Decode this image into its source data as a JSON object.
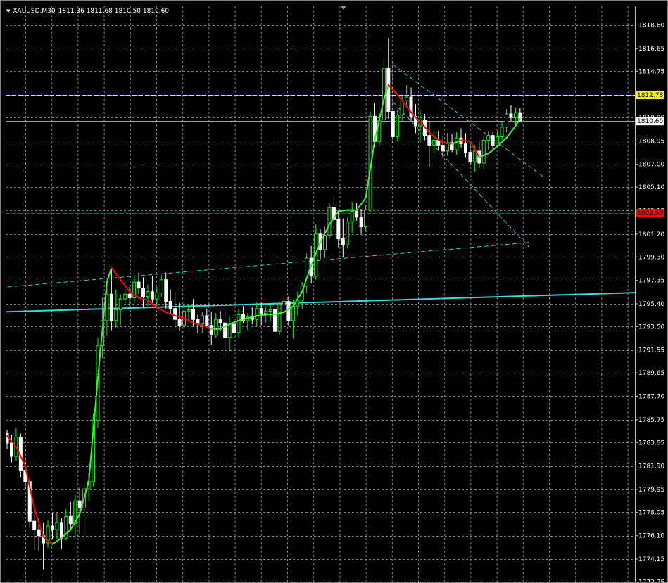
{
  "header": {
    "symbol_timeframe": "XAUUSD,M30",
    "ohlc": "1811.36 1811.68 1810.50 1810.60"
  },
  "colors": {
    "background": "#000000",
    "grid": "#808080",
    "bull_candle": "#00ff00",
    "bear_candle": "#ffffff",
    "ma_up": "#44ee44",
    "ma_down": "#ff0000",
    "support_line": "#33dddd",
    "dashed_channel": "#33cccc",
    "yellow_level": "#ffff00",
    "red_level": "#ff0000",
    "bid_line": "#9aa0a8"
  },
  "chart_data": {
    "type": "candlestick",
    "title": "",
    "xlabel": "",
    "ylabel": "",
    "grid": true,
    "ylim": [
      1772.25,
      1819.9
    ],
    "y_ticks": [
      "1818.60",
      "1816.65",
      "1814.75",
      "1812.80",
      "1810.90",
      "1808.95",
      "1807.00",
      "1805.10",
      "1803.15",
      "1801.20",
      "1799.30",
      "1797.35",
      "1795.40",
      "1793.50",
      "1791.55",
      "1789.65",
      "1787.70",
      "1785.75",
      "1783.85",
      "1781.90",
      "1779.95",
      "1778.05",
      "1776.10",
      "1774.15",
      "1772.25"
    ],
    "price_tags": [
      {
        "label": "1812.78",
        "value": 1812.78,
        "color": "#ffff00",
        "text_color": "#000000"
      },
      {
        "label": "1810.60",
        "value": 1810.6,
        "color": "#ffffff",
        "text_color": "#000000"
      },
      {
        "label": "1802.95",
        "value": 1802.95,
        "color": "#ff0000",
        "text_color": "#000000"
      }
    ],
    "candles": [
      [
        1784.6,
        1784.9,
        1783.3,
        1783.8
      ],
      [
        1783.8,
        1784.5,
        1782.2,
        1782.7
      ],
      [
        1782.7,
        1785.1,
        1782.3,
        1784.3
      ],
      [
        1784.3,
        1784.6,
        1781.0,
        1781.5
      ],
      [
        1781.5,
        1782.6,
        1780.0,
        1780.6
      ],
      [
        1780.6,
        1780.9,
        1776.7,
        1777.3
      ],
      [
        1777.3,
        1778.1,
        1774.9,
        1776.6
      ],
      [
        1776.6,
        1777.6,
        1774.8,
        1776.1
      ],
      [
        1776.1,
        1777.2,
        1773.3,
        1775.5
      ],
      [
        1775.5,
        1777.4,
        1775.1,
        1776.9
      ],
      [
        1776.9,
        1778.0,
        1775.8,
        1776.6
      ],
      [
        1776.6,
        1778.0,
        1775.8,
        1777.2
      ],
      [
        1777.2,
        1777.6,
        1775.0,
        1775.9
      ],
      [
        1775.9,
        1778.3,
        1775.7,
        1777.7
      ],
      [
        1777.7,
        1778.9,
        1776.6,
        1777.1
      ],
      [
        1777.1,
        1779.5,
        1775.9,
        1779.0
      ],
      [
        1779.0,
        1780.1,
        1776.2,
        1778.4
      ],
      [
        1778.4,
        1780.4,
        1775.7,
        1780.0
      ],
      [
        1780.0,
        1781.3,
        1779.0,
        1780.6
      ],
      [
        1780.6,
        1786.3,
        1780.2,
        1785.7
      ],
      [
        1785.7,
        1792.6,
        1785.1,
        1791.9
      ],
      [
        1791.9,
        1795.9,
        1790.9,
        1794.0
      ],
      [
        1794.0,
        1797.1,
        1792.7,
        1796.2
      ],
      [
        1796.2,
        1798.4,
        1793.2,
        1794.0
      ],
      [
        1794.0,
        1796.6,
        1793.4,
        1794.9
      ],
      [
        1794.9,
        1796.2,
        1793.6,
        1795.8
      ],
      [
        1795.8,
        1797.4,
        1795.3,
        1796.2
      ],
      [
        1796.2,
        1796.8,
        1795.2,
        1795.9
      ],
      [
        1795.9,
        1797.8,
        1795.5,
        1797.2
      ],
      [
        1797.2,
        1798.0,
        1796.2,
        1796.7
      ],
      [
        1796.7,
        1797.6,
        1795.1,
        1796.0
      ],
      [
        1796.0,
        1797.0,
        1795.2,
        1796.4
      ],
      [
        1796.4,
        1797.7,
        1795.4,
        1795.8
      ],
      [
        1795.8,
        1796.8,
        1795.0,
        1796.3
      ],
      [
        1796.3,
        1797.8,
        1796.0,
        1797.4
      ],
      [
        1797.4,
        1798.0,
        1795.0,
        1795.6
      ],
      [
        1795.6,
        1796.6,
        1794.6,
        1795.0
      ],
      [
        1795.0,
        1796.4,
        1793.4,
        1794.1
      ],
      [
        1794.1,
        1795.5,
        1793.2,
        1793.6
      ],
      [
        1793.6,
        1795.2,
        1792.8,
        1794.8
      ],
      [
        1794.8,
        1795.4,
        1794.0,
        1794.9
      ],
      [
        1794.9,
        1795.8,
        1793.6,
        1794.1
      ],
      [
        1794.1,
        1794.5,
        1793.0,
        1793.7
      ],
      [
        1793.7,
        1794.7,
        1793.0,
        1794.4
      ],
      [
        1794.4,
        1795.0,
        1793.4,
        1793.6
      ],
      [
        1793.6,
        1794.7,
        1792.0,
        1792.8
      ],
      [
        1792.8,
        1794.6,
        1792.6,
        1794.1
      ],
      [
        1794.1,
        1794.8,
        1793.1,
        1793.8
      ],
      [
        1793.8,
        1795.0,
        1791.0,
        1792.6
      ],
      [
        1792.6,
        1794.3,
        1791.5,
        1793.7
      ],
      [
        1793.7,
        1794.4,
        1792.5,
        1793.0
      ],
      [
        1793.0,
        1795.0,
        1792.6,
        1794.5
      ],
      [
        1794.5,
        1795.2,
        1793.8,
        1794.0
      ],
      [
        1794.0,
        1794.6,
        1793.2,
        1794.3
      ],
      [
        1794.3,
        1795.1,
        1793.7,
        1794.1
      ],
      [
        1794.1,
        1795.5,
        1793.5,
        1795.0
      ],
      [
        1795.0,
        1795.5,
        1793.6,
        1794.6
      ],
      [
        1794.6,
        1795.2,
        1793.8,
        1794.8
      ],
      [
        1794.8,
        1795.3,
        1794.0,
        1794.9
      ],
      [
        1794.9,
        1795.4,
        1792.5,
        1793.1
      ],
      [
        1793.1,
        1795.6,
        1792.8,
        1795.3
      ],
      [
        1795.3,
        1795.9,
        1794.5,
        1795.6
      ],
      [
        1795.6,
        1796.0,
        1793.6,
        1794.0
      ],
      [
        1794.0,
        1795.7,
        1792.5,
        1795.2
      ],
      [
        1795.2,
        1796.4,
        1794.4,
        1795.7
      ],
      [
        1795.7,
        1797.2,
        1795.0,
        1796.9
      ],
      [
        1796.9,
        1799.6,
        1796.3,
        1799.2
      ],
      [
        1799.2,
        1800.2,
        1797.1,
        1797.7
      ],
      [
        1797.7,
        1802.0,
        1797.4,
        1801.2
      ],
      [
        1801.2,
        1801.6,
        1799.1,
        1799.9
      ],
      [
        1799.9,
        1801.8,
        1799.2,
        1801.1
      ],
      [
        1801.1,
        1803.8,
        1800.8,
        1803.4
      ],
      [
        1803.4,
        1804.3,
        1801.6,
        1802.4
      ],
      [
        1802.4,
        1803.2,
        1800.1,
        1800.8
      ],
      [
        1800.8,
        1802.5,
        1799.3,
        1800.3
      ],
      [
        1800.3,
        1802.6,
        1800.0,
        1802.2
      ],
      [
        1802.2,
        1803.9,
        1801.3,
        1803.1
      ],
      [
        1803.1,
        1803.8,
        1802.3,
        1802.6
      ],
      [
        1802.6,
        1803.3,
        1801.2,
        1801.8
      ],
      [
        1801.8,
        1803.6,
        1801.4,
        1803.2
      ],
      [
        1803.2,
        1811.4,
        1803.0,
        1811.0
      ],
      [
        1811.0,
        1812.1,
        1808.4,
        1808.9
      ],
      [
        1808.9,
        1811.3,
        1808.5,
        1810.7
      ],
      [
        1810.7,
        1815.7,
        1810.2,
        1815.0
      ],
      [
        1815.0,
        1817.5,
        1810.8,
        1811.4
      ],
      [
        1811.4,
        1815.6,
        1808.8,
        1809.3
      ],
      [
        1809.3,
        1811.5,
        1808.9,
        1811.1
      ],
      [
        1811.1,
        1812.7,
        1810.6,
        1812.3
      ],
      [
        1812.3,
        1813.6,
        1811.9,
        1812.6
      ],
      [
        1812.6,
        1813.4,
        1810.6,
        1811.0
      ],
      [
        1811.0,
        1812.0,
        1809.6,
        1810.2
      ],
      [
        1810.2,
        1811.5,
        1808.8,
        1810.7
      ],
      [
        1810.7,
        1811.2,
        1809.0,
        1809.4
      ],
      [
        1809.4,
        1810.6,
        1806.8,
        1808.6
      ],
      [
        1808.6,
        1809.8,
        1807.9,
        1809.0
      ],
      [
        1809.0,
        1809.8,
        1808.2,
        1808.6
      ],
      [
        1808.6,
        1809.4,
        1807.5,
        1808.1
      ],
      [
        1808.1,
        1809.6,
        1807.7,
        1808.8
      ],
      [
        1808.8,
        1809.5,
        1808.0,
        1808.2
      ],
      [
        1808.2,
        1809.7,
        1807.8,
        1809.2
      ],
      [
        1809.2,
        1810.0,
        1808.4,
        1808.7
      ],
      [
        1808.7,
        1809.6,
        1807.6,
        1808.0
      ],
      [
        1808.0,
        1808.8,
        1806.9,
        1807.2
      ],
      [
        1807.2,
        1808.6,
        1806.4,
        1808.1
      ],
      [
        1808.1,
        1808.9,
        1806.7,
        1807.1
      ],
      [
        1807.1,
        1809.3,
        1806.6,
        1809.0
      ],
      [
        1809.0,
        1809.8,
        1808.2,
        1809.4
      ],
      [
        1809.4,
        1809.7,
        1808.3,
        1808.6
      ],
      [
        1808.6,
        1809.8,
        1808.4,
        1809.3
      ],
      [
        1809.3,
        1810.5,
        1809.0,
        1810.1
      ],
      [
        1810.1,
        1811.6,
        1809.7,
        1811.2
      ],
      [
        1811.2,
        1811.9,
        1810.6,
        1810.9
      ],
      [
        1810.9,
        1811.7,
        1810.3,
        1811.3
      ],
      [
        1811.3,
        1811.7,
        1810.5,
        1810.6
      ]
    ],
    "ma": [
      [
        0,
        1784.4
      ],
      [
        2,
        1783.5
      ],
      [
        4,
        1781.9
      ],
      [
        6,
        1778.4
      ],
      [
        8,
        1776.0
      ],
      [
        10,
        1775.4
      ],
      [
        12,
        1775.9
      ],
      [
        14,
        1776.6
      ],
      [
        16,
        1777.9
      ],
      [
        18,
        1780.6
      ],
      [
        20,
        1789.2
      ],
      [
        22,
        1797.2
      ],
      [
        23,
        1798.4
      ],
      [
        25,
        1797.4
      ],
      [
        27,
        1796.4
      ],
      [
        29,
        1795.9
      ],
      [
        31,
        1795.7
      ],
      [
        33,
        1795.1
      ],
      [
        35,
        1794.7
      ],
      [
        37,
        1794.4
      ],
      [
        39,
        1794.2
      ],
      [
        41,
        1793.8
      ],
      [
        43,
        1793.6
      ],
      [
        45,
        1793.3
      ],
      [
        47,
        1793.3
      ],
      [
        49,
        1793.7
      ],
      [
        51,
        1794.0
      ],
      [
        53,
        1794.2
      ],
      [
        55,
        1794.4
      ],
      [
        57,
        1794.5
      ],
      [
        59,
        1794.5
      ],
      [
        61,
        1794.7
      ],
      [
        63,
        1795.2
      ],
      [
        65,
        1796.4
      ],
      [
        67,
        1798.6
      ],
      [
        69,
        1800.5
      ],
      [
        71,
        1802.0
      ],
      [
        73,
        1803.1
      ],
      [
        75,
        1803.2
      ],
      [
        77,
        1803.2
      ],
      [
        79,
        1804.2
      ],
      [
        81,
        1809.0
      ],
      [
        83,
        1812.4
      ],
      [
        84,
        1813.6
      ],
      [
        86,
        1812.8
      ],
      [
        88,
        1811.8
      ],
      [
        90,
        1810.9
      ],
      [
        92,
        1810.1
      ],
      [
        94,
        1809.3
      ],
      [
        96,
        1808.8
      ],
      [
        98,
        1808.7
      ],
      [
        100,
        1809.0
      ],
      [
        102,
        1808.9
      ],
      [
        104,
        1807.6
      ],
      [
        106,
        1807.9
      ],
      [
        108,
        1808.5
      ],
      [
        110,
        1809.2
      ],
      [
        112,
        1810.2
      ],
      [
        113,
        1810.8
      ]
    ],
    "lines": [
      {
        "name": "",
        "style": "solid",
        "color": "#33dddd",
        "points": [
          [
            -3,
            1794.7
          ],
          [
            145,
            1796.4
          ]
        ]
      },
      {
        "name": "",
        "style": "dashed",
        "color": "#33cccc",
        "points": [
          [
            -3,
            1796.7
          ],
          [
            115,
            1800.5
          ]
        ]
      },
      {
        "name": "",
        "style": "dashed",
        "color": "#33cccc",
        "points": [
          [
            85,
            1815.3
          ],
          [
            118,
            1806.0
          ]
        ]
      },
      {
        "name": "",
        "style": "dashed",
        "color": "#33cccc",
        "points": [
          [
            85,
            1812.2
          ],
          [
            115,
            1800.1
          ]
        ]
      }
    ],
    "levels": [
      {
        "value": 1812.78,
        "color": "#ffff00",
        "style": "dashed"
      },
      {
        "value": 1802.95,
        "color": "#ff0000",
        "style": "dashed"
      },
      {
        "value": 1810.6,
        "color": "#9aa0a8",
        "style": "solid"
      }
    ]
  }
}
